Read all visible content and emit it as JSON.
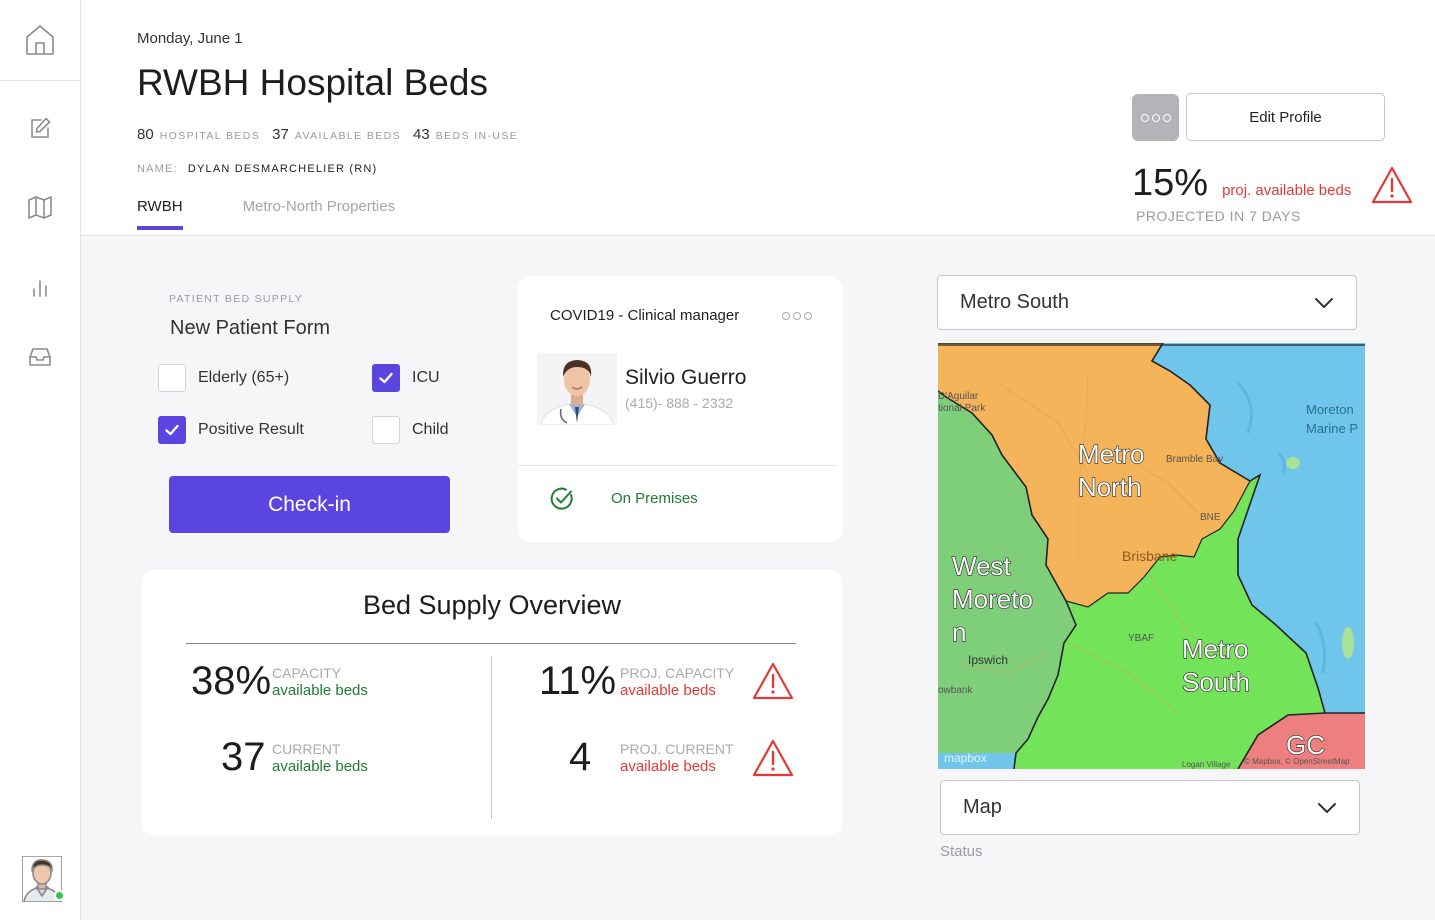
{
  "sidebar": {
    "items": [
      {
        "icon": "home-icon"
      },
      {
        "icon": "edit-icon"
      },
      {
        "icon": "map-icon"
      },
      {
        "icon": "chart-icon"
      },
      {
        "icon": "inbox-icon"
      }
    ],
    "online_color": "#33c24a"
  },
  "header": {
    "date": "Monday, June 1",
    "title": "RWBH Hospital Beds",
    "stats": [
      {
        "value": "80",
        "label": "HOSPITAL BEDS"
      },
      {
        "value": "37",
        "label": "AVAILABLE BEDS"
      },
      {
        "value": "43",
        "label": "BEDS IN-USE"
      }
    ],
    "name_label": "NAME:",
    "name_value": "DYLAN DESMARCHELIER (RN)",
    "tabs": [
      {
        "label": "RWBH",
        "active": true
      },
      {
        "label": "Metro-North Properties",
        "active": false
      }
    ],
    "edit_profile": "Edit Profile",
    "projection": {
      "value": "15%",
      "label": "proj. available beds",
      "sub": "PROJECTED IN 7 DAYS"
    }
  },
  "form": {
    "overline": "PATIENT BED SUPPLY",
    "title": "New Patient Form",
    "checkboxes": [
      {
        "label": "Elderly (65+)",
        "checked": false
      },
      {
        "label": "ICU",
        "checked": true
      },
      {
        "label": "Positive Result",
        "checked": true
      },
      {
        "label": "Child",
        "checked": false
      }
    ],
    "button": "Check-in"
  },
  "manager": {
    "role": "COVID19 - Clinical manager",
    "name": "Silvio Guerro",
    "phone": "(415)- 888 - 2332",
    "status": "On Premises"
  },
  "overview": {
    "title": "Bed Supply Overview",
    "stats": [
      {
        "value": "38%",
        "label": "CAPACITY",
        "sub": "available beds",
        "warning": false
      },
      {
        "value": "11%",
        "label": "PROJ. CAPACITY",
        "sub": "available beds",
        "warning": true
      },
      {
        "value": "37",
        "label": "CURRENT",
        "sub": "available beds",
        "warning": false
      },
      {
        "value": "4",
        "label": "PROJ. CURRENT",
        "sub": "available beds",
        "warning": true
      }
    ]
  },
  "map": {
    "region_select": "Metro South",
    "regions": [
      "Metro North",
      "West Moreton",
      "Metro South",
      "GC"
    ],
    "places": [
      "Moreton Marine P",
      "Bramble Bay",
      "Brisbane",
      "BNE",
      "YBAF",
      "Ipswich",
      "D'Aguilar",
      "tional Park",
      "owbank",
      "Logan Village",
      "mapbox",
      "© Mapbox, © OpenStreetMap"
    ],
    "view_select": "Map",
    "view_label": "Status"
  },
  "colors": {
    "accent": "#5b45e0",
    "success": "#1e7d32",
    "danger": "#e53935",
    "metro_north": "#f5b45a",
    "metro_south": "#73e35a",
    "west_moreton": "#7fcf7a",
    "gc": "#ee7f7f",
    "water": "#6fc6ea"
  }
}
